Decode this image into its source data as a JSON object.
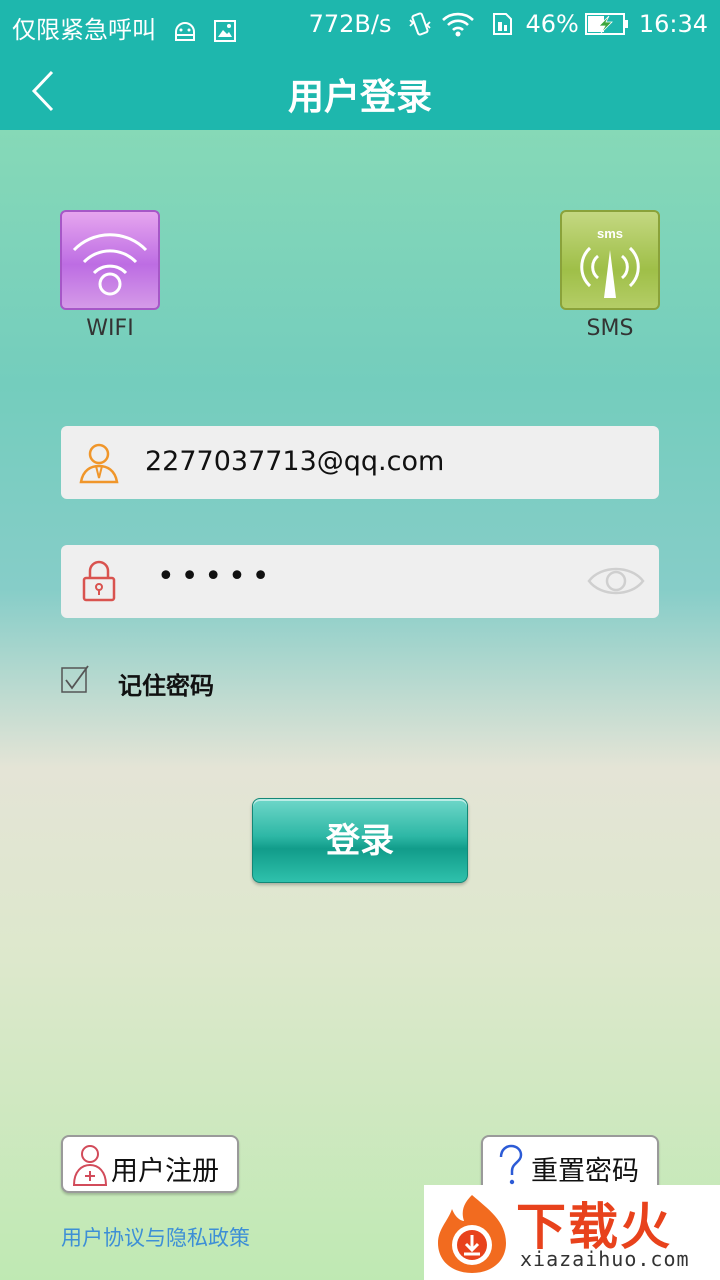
{
  "status_bar": {
    "carrier": "仅限紧急呼叫",
    "net_speed": "772B/s",
    "battery_percent": "46%",
    "time": "16:34"
  },
  "header": {
    "title": "用户登录"
  },
  "modes": [
    {
      "label": "WIFI",
      "icon": "wifi-icon"
    },
    {
      "label": "SMS",
      "icon": "sms-antenna-icon",
      "icon_text": "sms"
    }
  ],
  "form": {
    "username_value": "2277037713@qq.com",
    "password_mask": "•••••",
    "remember_label": "记住密码",
    "remember_checked": true
  },
  "login_button": "登录",
  "footer": {
    "register_label": "用户注册",
    "reset_label": "重置密码",
    "policy_link": "用户协议与隐私政策"
  },
  "watermark": {
    "title": "下载火",
    "subtitle": "xiazaihuo.com"
  },
  "colors": {
    "header_bg": "#1eb7ad",
    "link": "#3d8fd6",
    "watermark_red": "#e8421c"
  }
}
